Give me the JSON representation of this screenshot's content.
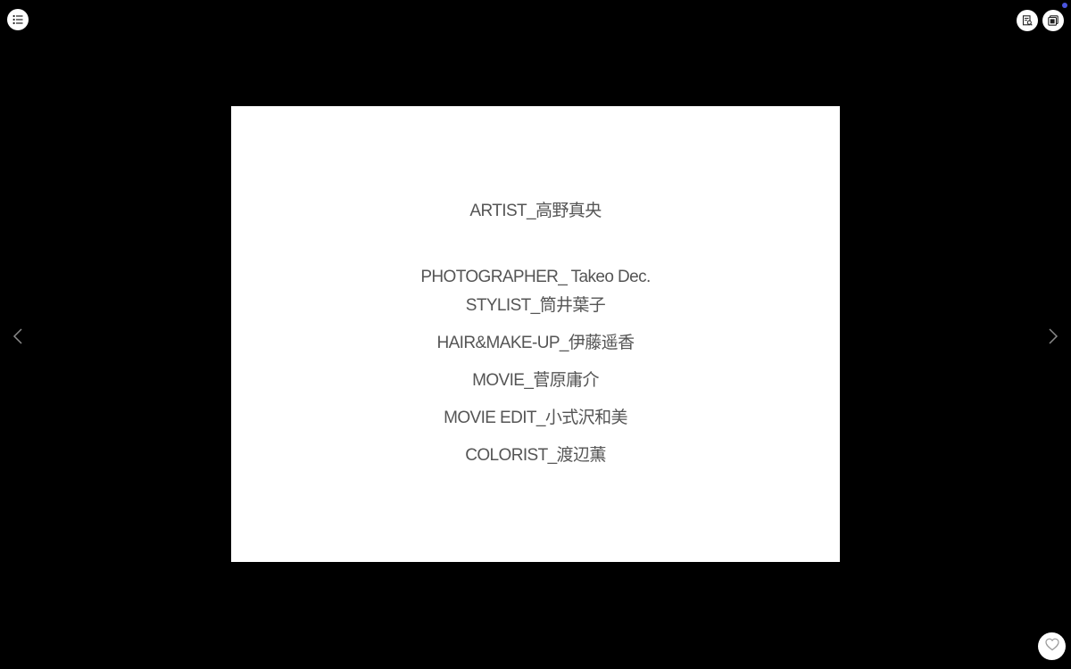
{
  "toolbar": {
    "toc_icon": "list-icon",
    "info_icon": "page-info-icon",
    "gallery_icon": "thumbnails-icon",
    "notification_dot_color": "#4b55e0"
  },
  "navigation": {
    "prev_icon": "chevron-left-icon",
    "next_icon": "chevron-right-icon"
  },
  "page": {
    "credits": [
      "ARTIST_高野真央",
      "PHOTOGRAPHER_ Takeo Dec.",
      "STYLIST_筒井葉子",
      "HAIR&MAKE-UP_伊藤遥香",
      "MOVIE_菅原庸介",
      "MOVIE EDIT_小式沢和美",
      "COLORIST_渡辺薫"
    ]
  },
  "like": {
    "icon": "heart-icon"
  }
}
